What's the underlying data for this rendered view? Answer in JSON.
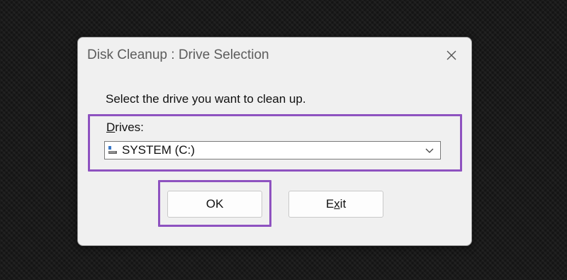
{
  "dialog": {
    "title": "Disk Cleanup : Drive Selection",
    "prompt": "Select the drive you want to clean up.",
    "drives_label_mnemonic": "D",
    "drives_label_rest": "rives:",
    "selected_drive": "SYSTEM (C:)",
    "ok_label": "OK",
    "exit_label_pre": "E",
    "exit_label_mnemonic": "x",
    "exit_label_post": "it"
  },
  "icons": {
    "close": "close-icon",
    "drive": "drive-icon",
    "dropdown": "chevron-down-icon"
  },
  "colors": {
    "highlight": "#8e52c0",
    "dialog_bg": "#f0f0f0",
    "background": "#1a1a1a"
  }
}
